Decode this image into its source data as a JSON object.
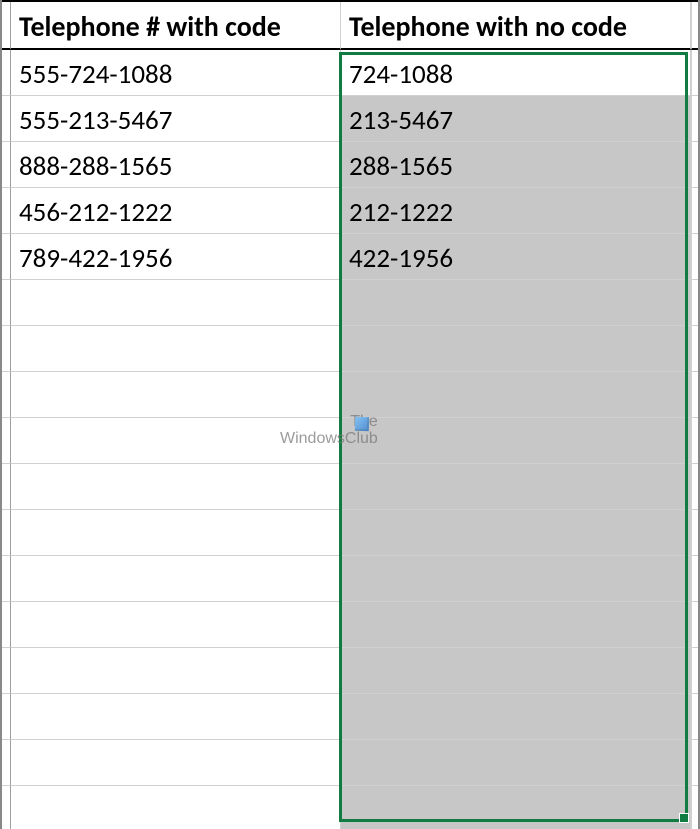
{
  "headers": {
    "colA": "Telephone # with code",
    "colB": "Telephone with no code"
  },
  "rows": [
    {
      "with_code": "555-724-1088",
      "no_code": "724-1088"
    },
    {
      "with_code": "555-213-5467",
      "no_code": "213-5467"
    },
    {
      "with_code": "888-288-1565",
      "no_code": "288-1565"
    },
    {
      "with_code": "456-212-1222",
      "no_code": "212-1222"
    },
    {
      "with_code": "789-422-1956",
      "no_code": "422-1956"
    }
  ],
  "empty_rows": 12,
  "watermark": {
    "line1": "The",
    "line2": "WindowsClub"
  }
}
